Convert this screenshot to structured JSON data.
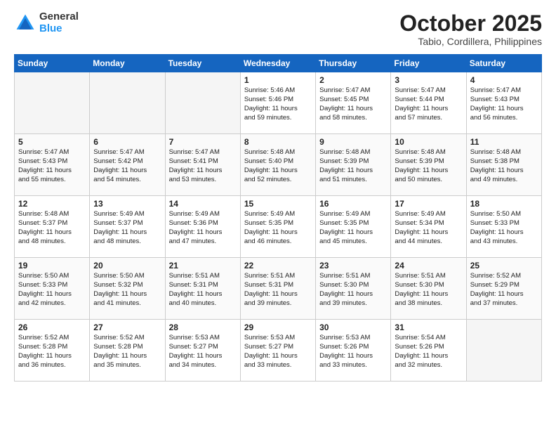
{
  "header": {
    "logo_general": "General",
    "logo_blue": "Blue",
    "title": "October 2025",
    "subtitle": "Tabio, Cordillera, Philippines"
  },
  "weekdays": [
    "Sunday",
    "Monday",
    "Tuesday",
    "Wednesday",
    "Thursday",
    "Friday",
    "Saturday"
  ],
  "weeks": [
    [
      {
        "day": "",
        "info": ""
      },
      {
        "day": "",
        "info": ""
      },
      {
        "day": "",
        "info": ""
      },
      {
        "day": "1",
        "info": "Sunrise: 5:46 AM\nSunset: 5:46 PM\nDaylight: 11 hours\nand 59 minutes."
      },
      {
        "day": "2",
        "info": "Sunrise: 5:47 AM\nSunset: 5:45 PM\nDaylight: 11 hours\nand 58 minutes."
      },
      {
        "day": "3",
        "info": "Sunrise: 5:47 AM\nSunset: 5:44 PM\nDaylight: 11 hours\nand 57 minutes."
      },
      {
        "day": "4",
        "info": "Sunrise: 5:47 AM\nSunset: 5:43 PM\nDaylight: 11 hours\nand 56 minutes."
      }
    ],
    [
      {
        "day": "5",
        "info": "Sunrise: 5:47 AM\nSunset: 5:43 PM\nDaylight: 11 hours\nand 55 minutes."
      },
      {
        "day": "6",
        "info": "Sunrise: 5:47 AM\nSunset: 5:42 PM\nDaylight: 11 hours\nand 54 minutes."
      },
      {
        "day": "7",
        "info": "Sunrise: 5:47 AM\nSunset: 5:41 PM\nDaylight: 11 hours\nand 53 minutes."
      },
      {
        "day": "8",
        "info": "Sunrise: 5:48 AM\nSunset: 5:40 PM\nDaylight: 11 hours\nand 52 minutes."
      },
      {
        "day": "9",
        "info": "Sunrise: 5:48 AM\nSunset: 5:39 PM\nDaylight: 11 hours\nand 51 minutes."
      },
      {
        "day": "10",
        "info": "Sunrise: 5:48 AM\nSunset: 5:39 PM\nDaylight: 11 hours\nand 50 minutes."
      },
      {
        "day": "11",
        "info": "Sunrise: 5:48 AM\nSunset: 5:38 PM\nDaylight: 11 hours\nand 49 minutes."
      }
    ],
    [
      {
        "day": "12",
        "info": "Sunrise: 5:48 AM\nSunset: 5:37 PM\nDaylight: 11 hours\nand 48 minutes."
      },
      {
        "day": "13",
        "info": "Sunrise: 5:49 AM\nSunset: 5:37 PM\nDaylight: 11 hours\nand 48 minutes."
      },
      {
        "day": "14",
        "info": "Sunrise: 5:49 AM\nSunset: 5:36 PM\nDaylight: 11 hours\nand 47 minutes."
      },
      {
        "day": "15",
        "info": "Sunrise: 5:49 AM\nSunset: 5:35 PM\nDaylight: 11 hours\nand 46 minutes."
      },
      {
        "day": "16",
        "info": "Sunrise: 5:49 AM\nSunset: 5:35 PM\nDaylight: 11 hours\nand 45 minutes."
      },
      {
        "day": "17",
        "info": "Sunrise: 5:49 AM\nSunset: 5:34 PM\nDaylight: 11 hours\nand 44 minutes."
      },
      {
        "day": "18",
        "info": "Sunrise: 5:50 AM\nSunset: 5:33 PM\nDaylight: 11 hours\nand 43 minutes."
      }
    ],
    [
      {
        "day": "19",
        "info": "Sunrise: 5:50 AM\nSunset: 5:33 PM\nDaylight: 11 hours\nand 42 minutes."
      },
      {
        "day": "20",
        "info": "Sunrise: 5:50 AM\nSunset: 5:32 PM\nDaylight: 11 hours\nand 41 minutes."
      },
      {
        "day": "21",
        "info": "Sunrise: 5:51 AM\nSunset: 5:31 PM\nDaylight: 11 hours\nand 40 minutes."
      },
      {
        "day": "22",
        "info": "Sunrise: 5:51 AM\nSunset: 5:31 PM\nDaylight: 11 hours\nand 39 minutes."
      },
      {
        "day": "23",
        "info": "Sunrise: 5:51 AM\nSunset: 5:30 PM\nDaylight: 11 hours\nand 39 minutes."
      },
      {
        "day": "24",
        "info": "Sunrise: 5:51 AM\nSunset: 5:30 PM\nDaylight: 11 hours\nand 38 minutes."
      },
      {
        "day": "25",
        "info": "Sunrise: 5:52 AM\nSunset: 5:29 PM\nDaylight: 11 hours\nand 37 minutes."
      }
    ],
    [
      {
        "day": "26",
        "info": "Sunrise: 5:52 AM\nSunset: 5:28 PM\nDaylight: 11 hours\nand 36 minutes."
      },
      {
        "day": "27",
        "info": "Sunrise: 5:52 AM\nSunset: 5:28 PM\nDaylight: 11 hours\nand 35 minutes."
      },
      {
        "day": "28",
        "info": "Sunrise: 5:53 AM\nSunset: 5:27 PM\nDaylight: 11 hours\nand 34 minutes."
      },
      {
        "day": "29",
        "info": "Sunrise: 5:53 AM\nSunset: 5:27 PM\nDaylight: 11 hours\nand 33 minutes."
      },
      {
        "day": "30",
        "info": "Sunrise: 5:53 AM\nSunset: 5:26 PM\nDaylight: 11 hours\nand 33 minutes."
      },
      {
        "day": "31",
        "info": "Sunrise: 5:54 AM\nSunset: 5:26 PM\nDaylight: 11 hours\nand 32 minutes."
      },
      {
        "day": "",
        "info": ""
      }
    ]
  ]
}
